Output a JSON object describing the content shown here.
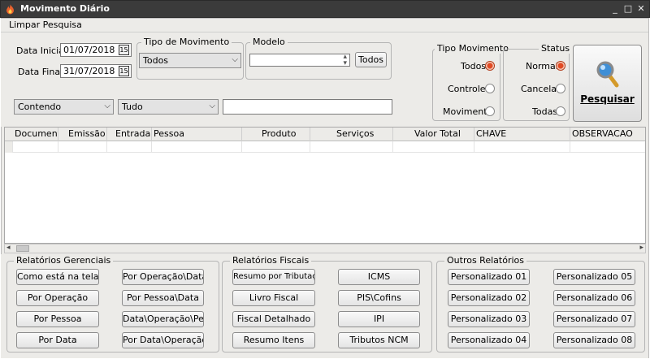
{
  "window": {
    "title": "Movimento Diário",
    "controls": [
      "_",
      "□",
      "✕"
    ]
  },
  "menu": {
    "clear_label": "Limpar Pesquisa"
  },
  "dates": {
    "start_label": "Data Inicial:",
    "start_value": "01/07/2018",
    "end_label": "Data Final:",
    "end_value": "31/07/2018",
    "calendar_glyph": "15"
  },
  "movement_type": {
    "title": "Tipo de Movimento",
    "selected": "Todos"
  },
  "model": {
    "title": "Modelo",
    "value": "",
    "button_label": "Todos"
  },
  "tipo_movimento_radio": {
    "title": "Tipo Movimento",
    "options": [
      {
        "label": "Todos",
        "checked": true
      },
      {
        "label": "Controles",
        "checked": false
      },
      {
        "label": "Movimento",
        "checked": false
      }
    ]
  },
  "status_radio": {
    "title": "Status",
    "options": [
      {
        "label": "Normal",
        "checked": true
      },
      {
        "label": "Cancelas",
        "checked": false
      },
      {
        "label": "Todas",
        "checked": false
      }
    ]
  },
  "search": {
    "button_label": "Pesquisar",
    "icon": "magnifier-icon",
    "filter_mode": "Contendo",
    "filter_field": "Tudo",
    "filter_text": ""
  },
  "grid": {
    "columns": [
      "Documento",
      "Emissão",
      "Entrada",
      "Pessoa",
      "Produto",
      "Serviços",
      "Valor Total",
      "CHAVE",
      "OBSERVACAO"
    ]
  },
  "reports": {
    "gerenciais": {
      "title": "Relatórios Gerenciais",
      "buttons": [
        "Como está na tela",
        "Por Operação\\Data",
        "Por Operação",
        "Por Pessoa\\Data",
        "Por Pessoa",
        "Data\\Operação\\Pessoa",
        "Por Data",
        "Por Data\\Operação"
      ]
    },
    "fiscais": {
      "title": "Relatórios Fiscais",
      "buttons": [
        "Resumo por Tributação",
        "ICMS",
        "Livro Fiscal",
        "PIS\\Cofins",
        "Fiscal Detalhado",
        "IPI",
        "Resumo Itens",
        "Tributos NCM"
      ]
    },
    "outros": {
      "title": "Outros Relatórios",
      "buttons": [
        "Personalizado 01",
        "Personalizado 05",
        "Personalizado 02",
        "Personalizado 06",
        "Personalizado 03",
        "Personalizado 07",
        "Personalizado 04",
        "Personalizado 08"
      ]
    }
  },
  "colors": {
    "titlebar": "#3b3b3b",
    "panel": "#ecebe8",
    "radio_checked": "#e04a24"
  }
}
